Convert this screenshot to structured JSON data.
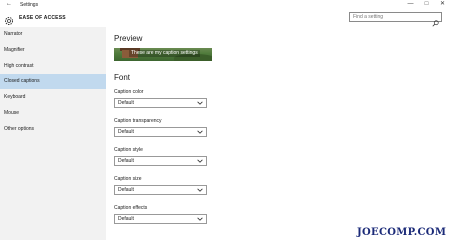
{
  "window": {
    "title": "Settings",
    "back_glyph": "←",
    "minimize_glyph": "—",
    "maximize_glyph": "□",
    "close_glyph": "✕"
  },
  "header": {
    "title": "EASE OF ACCESS",
    "icon": "gear-icon"
  },
  "search": {
    "placeholder": "Find a setting",
    "icon": "search-icon"
  },
  "sidebar": {
    "items": [
      {
        "label": "Narrator"
      },
      {
        "label": "Magnifier"
      },
      {
        "label": "High contrast"
      },
      {
        "label": "Closed captions",
        "active": true
      },
      {
        "label": "Keyboard"
      },
      {
        "label": "Mouse"
      },
      {
        "label": "Other options"
      }
    ]
  },
  "main": {
    "preview_title": "Preview",
    "preview_caption": "These are my caption settings",
    "font_title": "Font",
    "fields": [
      {
        "label": "Caption color",
        "value": "Default"
      },
      {
        "label": "Caption transparency",
        "value": "Default"
      },
      {
        "label": "Caption style",
        "value": "Default"
      },
      {
        "label": "Caption size",
        "value": "Default"
      },
      {
        "label": "Caption effects",
        "value": "Default"
      }
    ]
  },
  "watermark": "JOECOMP.COM",
  "colors": {
    "sidebar_bg": "#f2f2f2",
    "active_item_bg": "#c1d9ee",
    "watermark": "#1b2a78"
  }
}
